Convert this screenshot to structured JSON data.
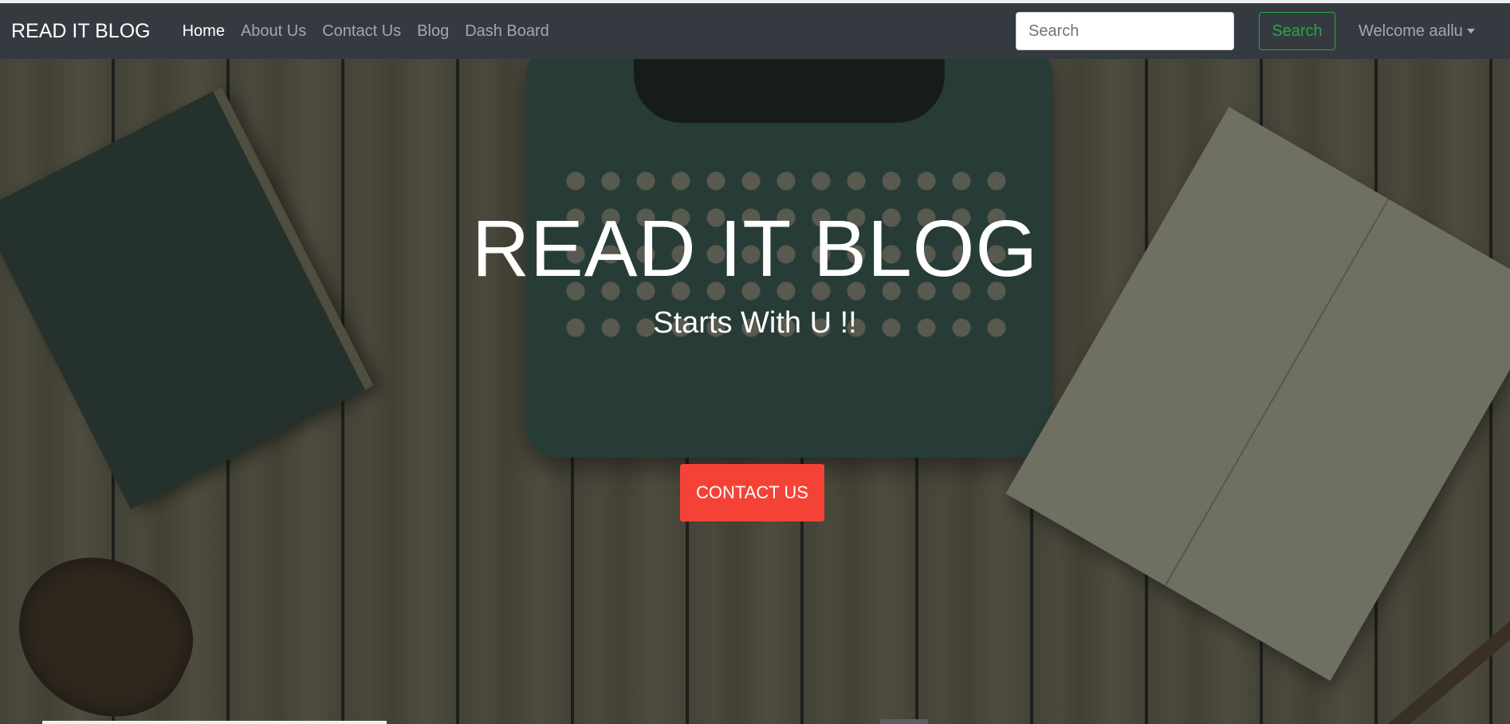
{
  "navbar": {
    "brand": "READ IT BLOG",
    "links": [
      {
        "label": "Home",
        "active": true
      },
      {
        "label": "About Us"
      },
      {
        "label": "Contact Us"
      },
      {
        "label": "Blog"
      },
      {
        "label": "Dash Board"
      }
    ],
    "search": {
      "placeholder": "Search",
      "button_label": "Search"
    },
    "user_menu": {
      "label": "Welcome aallu",
      "icon": "caret-down-icon"
    }
  },
  "hero": {
    "title": "READ IT BLOG",
    "subtitle": "Starts With U !!",
    "cta_label": "CONTACT US"
  },
  "colors": {
    "navbar_bg": "#343a40",
    "search_button": "#28a745",
    "cta_bg": "#f44336"
  }
}
